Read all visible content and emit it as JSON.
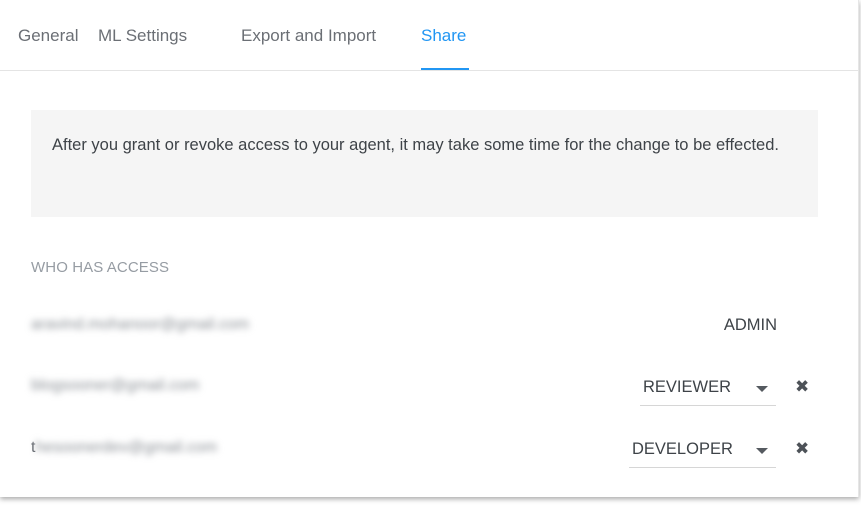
{
  "tabs": [
    {
      "label": "General"
    },
    {
      "label": "ML Settings"
    },
    {
      "label": "Export and Import"
    },
    {
      "label": "Share",
      "active": true
    }
  ],
  "accent_color": "#2196f3",
  "notice": {
    "text": "After you grant or revoke access to your agent, it may take some time for the change to be effected."
  },
  "access": {
    "title": "WHO HAS ACCESS",
    "users": [
      {
        "email_visible": "",
        "email_blurred": "aravind.mohanoor@gmail.com",
        "role": "ADMIN",
        "editable": false
      },
      {
        "email_visible": "",
        "email_blurred": "blogsooner@gmail.com",
        "role": "REVIEWER",
        "editable": true
      },
      {
        "email_visible": "t",
        "email_blurred": "hesoonerdev@gmail.com",
        "role": "DEVELOPER",
        "editable": true
      }
    ],
    "remove_icon": "close-icon"
  }
}
